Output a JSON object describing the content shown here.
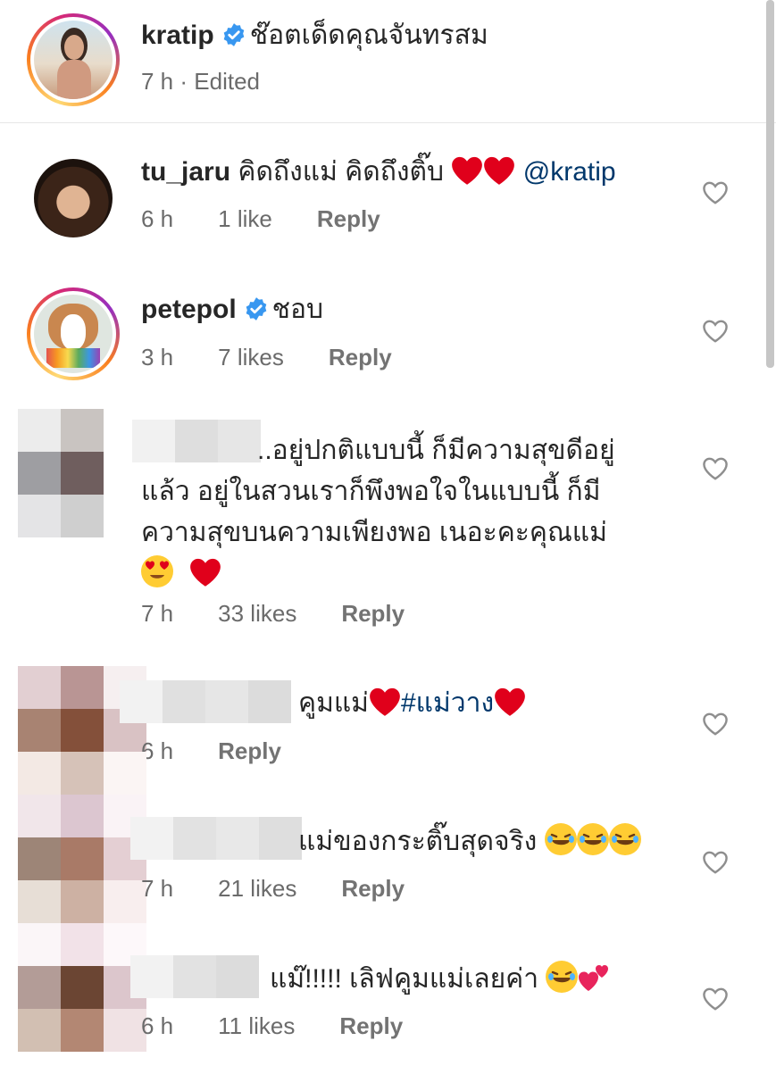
{
  "caption": {
    "username": "kratip",
    "text": "ช๊อตเด็ดคุณจันทรสม",
    "time": "7 h",
    "edited": "Edited"
  },
  "comments": [
    {
      "username": "tu_jaru",
      "text": "คิดถึงแม่ คิดถึงติ๊บ",
      "mention": "@kratip",
      "time": "6 h",
      "likes": "1 like",
      "reply": "Reply"
    },
    {
      "username": "petepol",
      "text": "ชอบ",
      "time": "3 h",
      "likes": "7 likes",
      "reply": "Reply"
    },
    {
      "text_line1": "..อยู่ปกติแบบนี้ ก็มีความสุขดีอยู่",
      "text_line2": "แล้ว อยู่ในสวนเราก็พึงพอใจในแบบนี้ ก็มี",
      "text_line3": "ความสุขบนความเพียงพอ เนอะคะคุณแม่",
      "time": "7 h",
      "likes": "33 likes",
      "reply": "Reply"
    },
    {
      "text": "คูมแม่",
      "hashtag": "#แม่วาง",
      "time": "6 h",
      "reply": "Reply"
    },
    {
      "text": "แม่ของกระติ๊บสุดจริง",
      "time": "7 h",
      "likes": "21 likes",
      "reply": "Reply"
    },
    {
      "text": "แม๊!!!!! เลิฟคูมแม่เลยค่า",
      "time": "6 h",
      "likes": "11 likes",
      "reply": "Reply"
    }
  ],
  "icons": {
    "verified": "verified-badge-icon",
    "like": "heart-outline-icon"
  },
  "colors": {
    "verified": "#3897f0",
    "mention": "#00376b",
    "heart": "#e0001b"
  }
}
